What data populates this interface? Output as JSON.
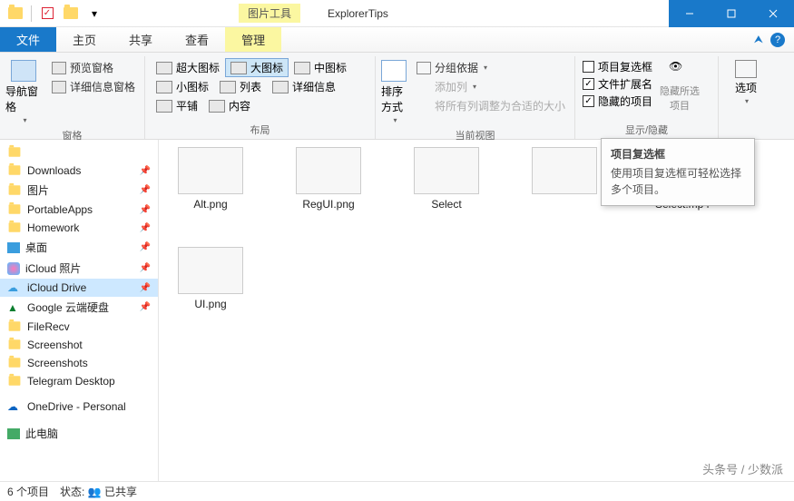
{
  "titlebar": {
    "tool_context": "图片工具",
    "title": "ExplorerTips"
  },
  "tabs": {
    "file": "文件",
    "home": "主页",
    "share": "共享",
    "view": "查看",
    "manage": "管理"
  },
  "ribbon": {
    "panes": {
      "nav_pane": "导航窗格",
      "preview_pane": "预览窗格",
      "details_pane": "详细信息窗格",
      "group": "窗格"
    },
    "layout": {
      "extra_large": "超大图标",
      "large": "大图标",
      "medium": "中图标",
      "small": "小图标",
      "list": "列表",
      "details": "详细信息",
      "tiles": "平铺",
      "content": "内容",
      "group": "布局"
    },
    "current_view": {
      "sort": "排序方式",
      "group_by": "分组依据",
      "add_columns": "添加列",
      "size_all": "将所有列调整为合适的大小",
      "group": "当前视图"
    },
    "show_hide": {
      "item_check": "项目复选框",
      "file_ext": "文件扩展名",
      "hidden": "隐藏的项目",
      "hide_selected": "隐藏所选项目",
      "group": "显示/隐藏"
    },
    "options": "选项"
  },
  "tooltip": {
    "title": "项目复选框",
    "body": "使用项目复选框可轻松选择多个项目。"
  },
  "nav": {
    "items": [
      "Downloads",
      "图片",
      "PortableApps",
      "Homework",
      "桌面",
      "iCloud 照片",
      "iCloud Drive",
      "Google 云端硬盘",
      "FileRecv",
      "Screenshot",
      "Screenshots",
      "Telegram Desktop",
      "OneDrive - Personal",
      "此电脑"
    ]
  },
  "files": {
    "items": [
      "Alt.png",
      "RegUI.png",
      "Select",
      "",
      "Select.mp4",
      "UI.png"
    ]
  },
  "status": {
    "count": "6 个项目",
    "state_label": "状态:",
    "shared": "已共享"
  },
  "watermark": "头条号 / 少数派"
}
